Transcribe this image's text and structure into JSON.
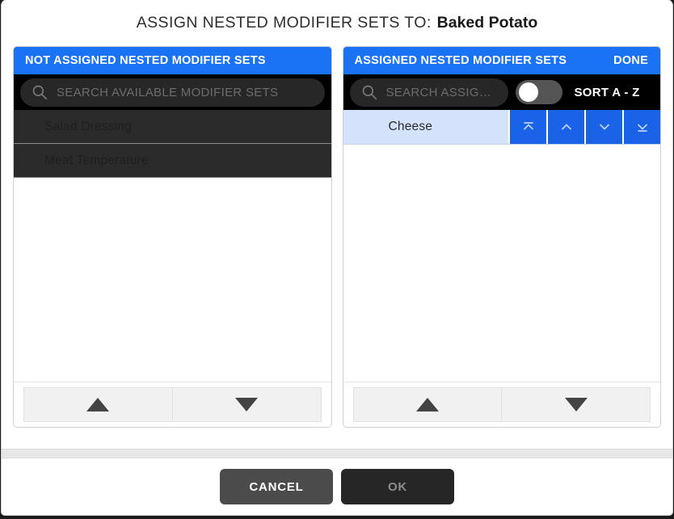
{
  "dialog": {
    "title_prefix": "ASSIGN NESTED MODIFIER SETS TO:",
    "title_item": "Baked Potato"
  },
  "left_panel": {
    "header_title": "NOT ASSIGNED NESTED MODIFIER SETS",
    "search_placeholder": "SEARCH AVAILABLE MODIFIER SETS",
    "search_icon": "search-icon",
    "items": [
      {
        "label": "Salad Dressing"
      },
      {
        "label": "Meat Temperature"
      }
    ],
    "scroll_up_icon": "triangle-up-icon",
    "scroll_down_icon": "triangle-down-icon"
  },
  "right_panel": {
    "header_title": "ASSIGNED NESTED MODIFIER SETS",
    "done_label": "DONE",
    "search_placeholder": "SEARCH ASSIGNED...",
    "search_icon": "search-icon",
    "sort_label": "SORT A - Z",
    "sort_toggle_on": false,
    "items": [
      {
        "label": "Cheese",
        "selected": true,
        "actions": [
          {
            "name": "move-to-top-icon"
          },
          {
            "name": "move-up-icon"
          },
          {
            "name": "move-down-icon"
          },
          {
            "name": "move-to-bottom-icon"
          }
        ]
      }
    ],
    "scroll_up_icon": "triangle-up-icon",
    "scroll_down_icon": "triangle-down-icon"
  },
  "footer": {
    "cancel_label": "CANCEL",
    "ok_label": "OK"
  },
  "colors": {
    "accent_blue": "#1a73f5",
    "action_blue": "#1a62e8",
    "selected_row": "#d4e2fb",
    "dark_row": "#2b2b2b",
    "search_bar": "#000000",
    "cancel_button": "#4b4b4b",
    "ok_button": "#262626"
  }
}
